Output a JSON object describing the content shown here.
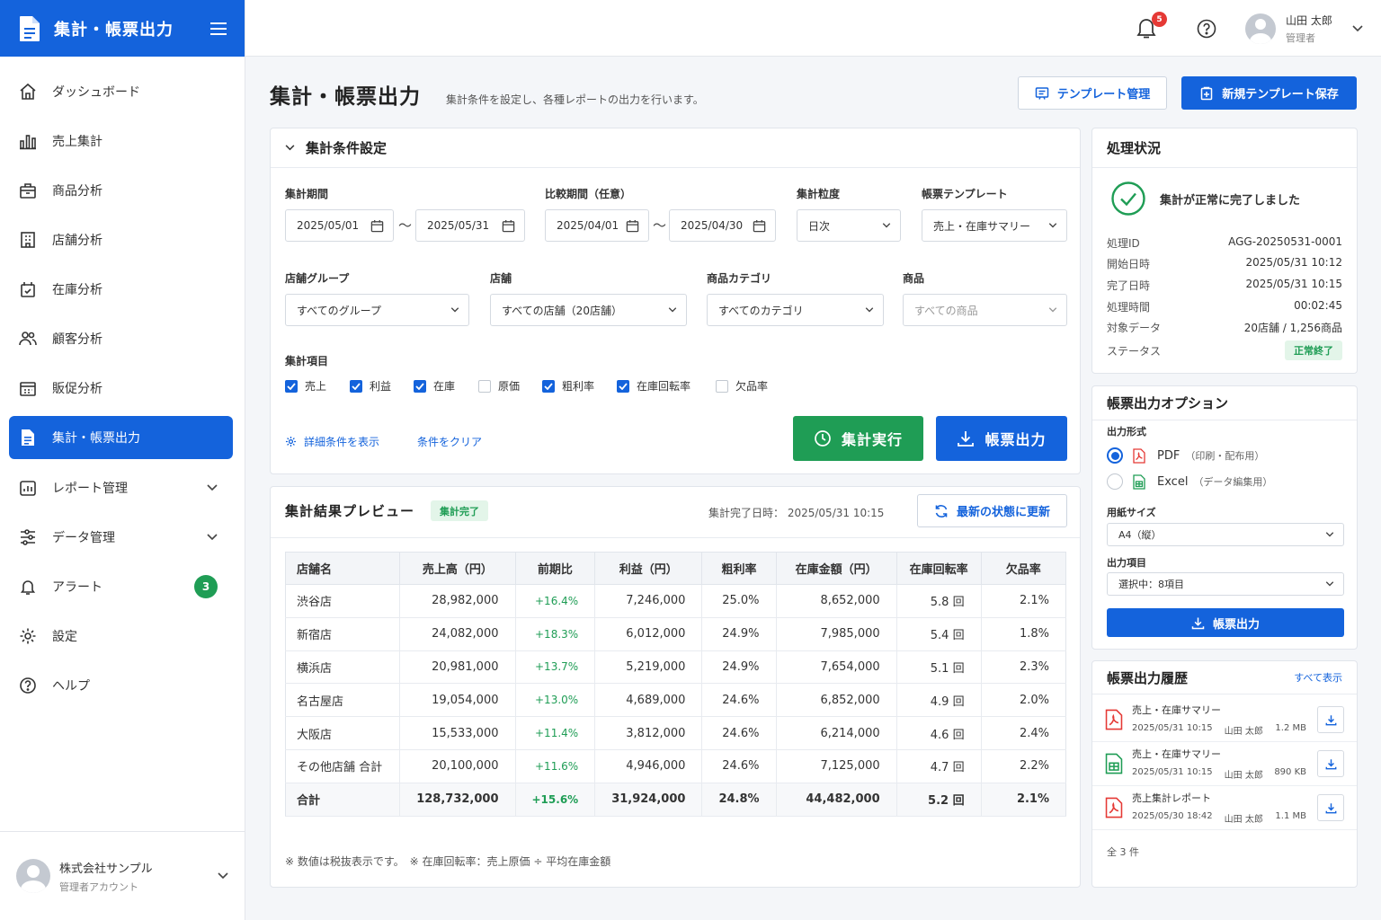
{
  "app": {
    "title": "集計・帳票出力"
  },
  "nav": [
    {
      "key": "dashboard",
      "label": "ダッシュボード"
    },
    {
      "key": "sales",
      "label": "売上集計"
    },
    {
      "key": "product",
      "label": "商品分析"
    },
    {
      "key": "store",
      "label": "店舗分析"
    },
    {
      "key": "inventory",
      "label": "在庫分析"
    },
    {
      "key": "customer",
      "label": "顧客分析"
    },
    {
      "key": "promo",
      "label": "販促分析"
    },
    {
      "key": "report_output",
      "label": "集計・帳票出力"
    },
    {
      "key": "report_mgmt",
      "label": "レポート管理"
    },
    {
      "key": "data_mgmt",
      "label": "データ管理"
    },
    {
      "key": "alert",
      "label": "アラート",
      "badge": "3"
    },
    {
      "key": "settings",
      "label": "設定"
    },
    {
      "key": "help",
      "label": "ヘルプ"
    }
  ],
  "account": {
    "name": "株式会社サンプル",
    "sub": "管理者アカウント"
  },
  "topbar": {
    "notification_count": "5",
    "user_name": "山田 太郎",
    "user_role": "管理者"
  },
  "page": {
    "title": "集計・帳票出力",
    "description": "集計条件を設定し、各種レポートの出力を行います。",
    "template_mgmt": "テンプレート管理",
    "save_template": "新規テンプレート保存"
  },
  "conditions": {
    "title": "集計条件設定",
    "period_label": "集計期間",
    "period_start": "2025/05/01",
    "period_end": "2025/05/31",
    "compare_label": "比較期間（任意）",
    "compare_start": "2025/04/01",
    "compare_end": "2025/04/30",
    "tilde": "〜",
    "granularity_label": "集計粒度",
    "granularity": "日次",
    "template_label": "帳票テンプレート",
    "template": "売上・在庫サマリー",
    "store_group_label": "店舗グループ",
    "store_group": "すべてのグループ",
    "store_label": "店舗",
    "store": "すべての店舗（20店舗）",
    "category_label": "商品カテゴリ",
    "category": "すべてのカテゴリ",
    "product_label": "商品",
    "product_placeholder": "すべての商品",
    "items_label": "集計項目",
    "items": [
      {
        "label": "売上",
        "checked": true
      },
      {
        "label": "利益",
        "checked": true
      },
      {
        "label": "在庫",
        "checked": true
      },
      {
        "label": "原価",
        "checked": false
      },
      {
        "label": "粗利率",
        "checked": true
      },
      {
        "label": "在庫回転率",
        "checked": true
      },
      {
        "label": "欠品率",
        "checked": false
      }
    ],
    "show_detail": "詳細条件を表示",
    "clear": "条件をクリア",
    "run": "集計実行",
    "output": "帳票出力"
  },
  "preview": {
    "title": "集計結果プレビュー",
    "status": "集計完了",
    "completed_label": "集計完了日時：",
    "completed_at": "2025/05/31 10:15",
    "refresh": "最新の状態に更新",
    "columns": [
      "店舗名",
      "売上高（円）",
      "前期比",
      "利益（円）",
      "粗利率",
      "在庫金額（円）",
      "在庫回転率",
      "欠品率"
    ],
    "rows": [
      [
        "渋谷店",
        "28,982,000",
        "+16.4%",
        "7,246,000",
        "25.0%",
        "8,652,000",
        "5.8 回",
        "2.1%"
      ],
      [
        "新宿店",
        "24,082,000",
        "+18.3%",
        "6,012,000",
        "24.9%",
        "7,985,000",
        "5.4 回",
        "1.8%"
      ],
      [
        "横浜店",
        "20,981,000",
        "+13.7%",
        "5,219,000",
        "24.9%",
        "7,654,000",
        "5.1 回",
        "2.3%"
      ],
      [
        "名古屋店",
        "19,054,000",
        "+13.0%",
        "4,689,000",
        "24.6%",
        "6,852,000",
        "4.9 回",
        "2.0%"
      ],
      [
        "大阪店",
        "15,533,000",
        "+11.4%",
        "3,812,000",
        "24.6%",
        "6,214,000",
        "4.6 回",
        "2.4%"
      ],
      [
        "その他店舗 合計",
        "20,100,000",
        "+11.6%",
        "4,946,000",
        "24.6%",
        "7,125,000",
        "4.7 回",
        "2.2%"
      ]
    ],
    "total": [
      "合計",
      "128,732,000",
      "+15.6%",
      "31,924,000",
      "24.8%",
      "44,482,000",
      "5.2 回",
      "2.1%"
    ],
    "note": "※ 数値は税抜表示です。　※ 在庫回転率：売上原価 ÷ 平均在庫金額"
  },
  "process": {
    "title": "処理状況",
    "message": "集計が正常に完了しました",
    "fields": [
      {
        "label": "処理ID",
        "value": "AGG-20250531-0001"
      },
      {
        "label": "開始日時",
        "value": "2025/05/31 10:12"
      },
      {
        "label": "完了日時",
        "value": "2025/05/31 10:15"
      },
      {
        "label": "処理時間",
        "value": "00:02:45"
      },
      {
        "label": "対象データ",
        "value": "20店舗 / 1,256商品"
      }
    ],
    "status_label": "ステータス",
    "status_value": "正常終了"
  },
  "options": {
    "title": "帳票出力オプション",
    "format_label": "出力形式",
    "formats": [
      {
        "label": "PDF",
        "sub": "（印刷・配布用）",
        "selected": true
      },
      {
        "label": "Excel",
        "sub": "（データ編集用）",
        "selected": false
      }
    ],
    "paper_label": "用紙サイズ",
    "paper": "A4（縦）",
    "items_label": "出力項目",
    "items": "選択中：8項目",
    "output": "帳票出力"
  },
  "history": {
    "title": "帳票出力履歴",
    "show_all": "すべて表示",
    "items": [
      {
        "name": "売上・在庫サマリー",
        "date": "2025/05/31 10:15",
        "user": "山田 太郎",
        "size": "1.2 MB",
        "type": "pdf"
      },
      {
        "name": "売上・在庫サマリー",
        "date": "2025/05/31 10:15",
        "user": "山田 太郎",
        "size": "890 KB",
        "type": "excel"
      },
      {
        "name": "売上集計レポート",
        "date": "2025/05/30 18:42",
        "user": "山田 太郎",
        "size": "1.1 MB",
        "type": "pdf"
      }
    ],
    "count": "全 3 件"
  },
  "colors": {
    "primary": "#1463dc",
    "success": "#1f9d55",
    "danger": "#e53935"
  }
}
